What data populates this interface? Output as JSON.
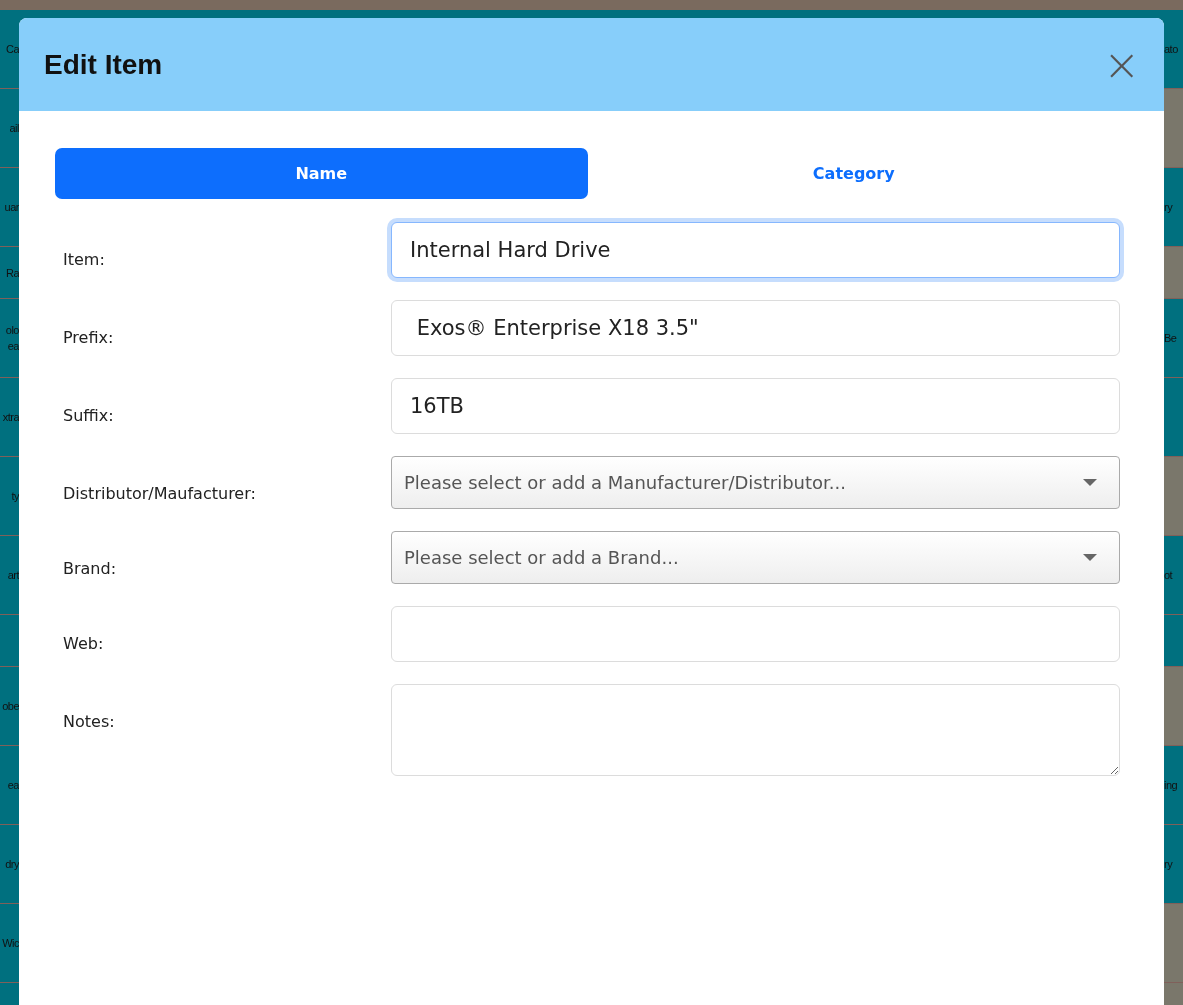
{
  "background_table": {
    "rows": [
      {
        "left": [
          "Ca"
        ],
        "right": "ato",
        "shaded": false
      },
      {
        "left": [
          "ail"
        ],
        "shaded": true
      },
      {
        "left": [
          "uar"
        ],
        "right": "ry",
        "shaded": false
      },
      {
        "left": [
          "Ra"
        ],
        "shaded": true
      },
      {
        "left": [
          "olo",
          "ea"
        ],
        "right": "Be",
        "shaded": false
      },
      {
        "left": [
          "xtra"
        ],
        "shaded": false
      },
      {
        "left": [
          "ty"
        ],
        "shaded": true
      },
      {
        "left": [
          "art"
        ],
        "right": "ot",
        "shaded": false
      },
      {
        "shaded": false
      },
      {
        "left": [
          "obe"
        ],
        "shaded": true
      },
      {
        "left": [
          "ea"
        ],
        "right": "ing",
        "shaded": false
      },
      {
        "left": [
          "dry"
        ],
        "right": "ry",
        "shaded": false
      },
      {
        "left": [
          "Wic"
        ],
        "shaded": true
      },
      {
        "shaded": true
      }
    ]
  },
  "dialog": {
    "title": "Edit Item",
    "close": "×",
    "tabs": [
      {
        "label": "Name",
        "selected": true
      },
      {
        "label": "Category",
        "selected": false
      }
    ],
    "fields": [
      {
        "label": "Item:",
        "kind": "text",
        "value": "Internal Hard Drive",
        "focused": true
      },
      {
        "label": "Prefix:",
        "kind": "text",
        "value": " Exos® Enterprise X18 3.5\"",
        "focused": false
      },
      {
        "label": "Suffix:",
        "kind": "text",
        "value": "16TB",
        "focused": false
      },
      {
        "label": "Distributor/Maufacturer:",
        "kind": "select",
        "placeholder": "Please select or add a Manufacturer/Distributor..."
      },
      {
        "label": "Brand:",
        "kind": "select",
        "placeholder": "Please select or add a Brand..."
      },
      {
        "label": "Web:",
        "kind": "text",
        "focused": false
      },
      {
        "label": "Notes:",
        "kind": "textarea"
      }
    ]
  }
}
